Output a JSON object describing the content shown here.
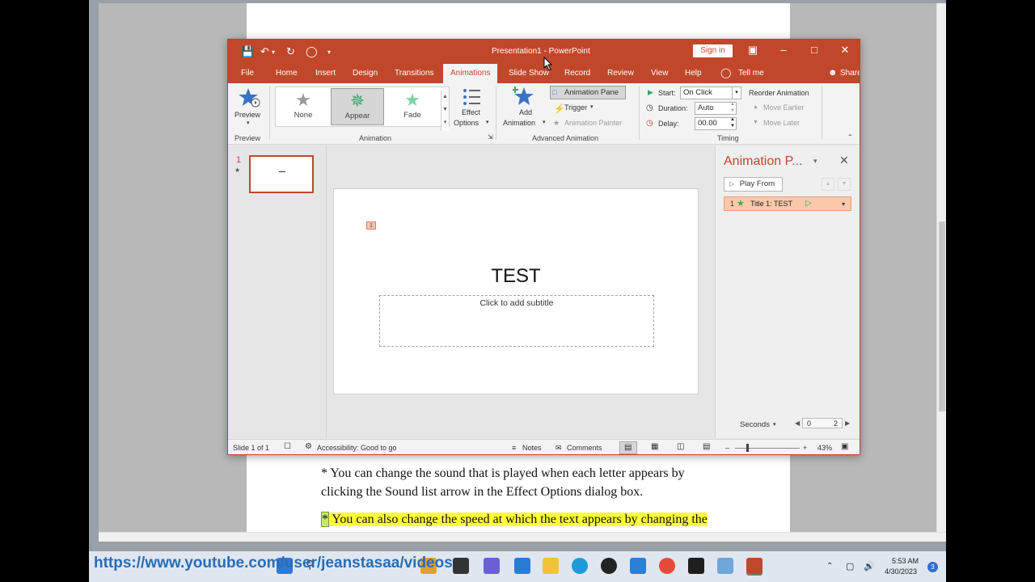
{
  "window": {
    "title": "Presentation1  -  PowerPoint",
    "sign_in": "Sign in"
  },
  "tabs": [
    "File",
    "Home",
    "Insert",
    "Design",
    "Transitions",
    "Animations",
    "Slide Show",
    "Record",
    "Review",
    "View",
    "Help",
    "Tell me",
    "Share"
  ],
  "active_tab": "Animations",
  "ribbon": {
    "preview_label": "Preview",
    "preview_group": "Preview",
    "gallery": [
      {
        "label": "None",
        "icon": "gray-star-icon",
        "color": "#9a9a9a"
      },
      {
        "label": "Appear",
        "icon": "green-starburst-icon",
        "color": "#3aa66a"
      },
      {
        "label": "Fade",
        "icon": "green-star-icon",
        "color": "#7fd0a8"
      }
    ],
    "effect_options_l1": "Effect",
    "effect_options_l2": "Options",
    "animation_group": "Animation",
    "add_animation_l1": "Add",
    "add_animation_l2": "Animation",
    "animation_pane_btn": "Animation Pane",
    "trigger": "Trigger",
    "animation_painter": "Animation Painter",
    "advanced_group": "Advanced Animation",
    "start_label": "Start:",
    "start_value": "On Click",
    "duration_label": "Duration:",
    "duration_value": "Auto",
    "delay_label": "Delay:",
    "delay_value": "00.00",
    "reorder": "Reorder Animation",
    "move_earlier": "Move Earlier",
    "move_later": "Move Later",
    "timing_group": "Timing"
  },
  "thumbnails": {
    "slide_number": "1",
    "star": "★"
  },
  "slide": {
    "anim_tag": "1",
    "title": "TEST",
    "subtitle_placeholder": "Click to add subtitle"
  },
  "animation_pane": {
    "title": "Animation P...",
    "play_from": "Play From",
    "item_number": "1",
    "item_label": "Title 1: TEST",
    "seconds": "Seconds",
    "timeline_start": "0",
    "timeline_end": "2"
  },
  "status": {
    "slide": "Slide 1 of 1",
    "accessibility": "Accessibility: Good to go",
    "notes": "Notes",
    "comments": "Comments",
    "zoom": "43%"
  },
  "document": {
    "line1": "* You can change the sound that is played when each letter appears by",
    "line2": "clicking the Sound list arrow in the Effect Options dialog box.",
    "line3_star": "*",
    "line3": " You can also change the speed at which the text appears by changing the"
  },
  "taskbar": {
    "url_overlay": "https://www.youtube.com/user/jeanstasaa/videos",
    "time": "5:53 AM",
    "date": "4/30/2023",
    "notifications": "3"
  },
  "colors": {
    "accent": "#c0472a",
    "highlight": "#ffff3a",
    "selected_anim": "#f9c9a9"
  }
}
